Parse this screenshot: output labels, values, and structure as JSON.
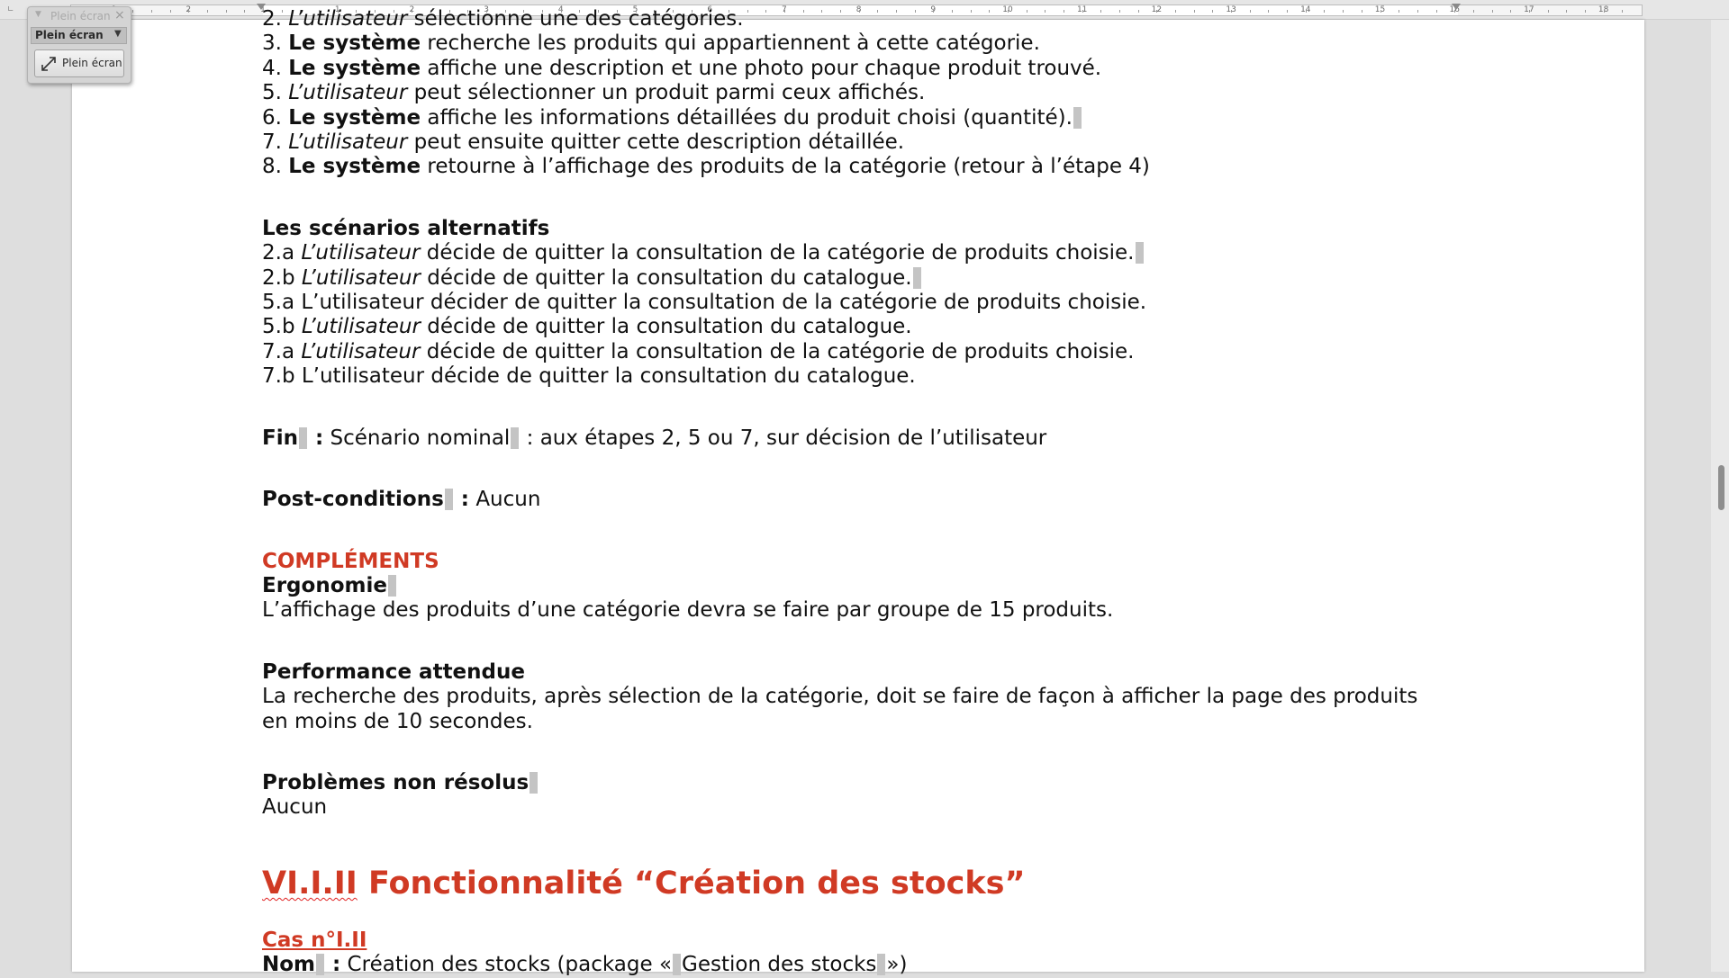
{
  "ruler": {
    "numbers": [
      "1",
      "2",
      "1",
      "1",
      "2",
      "3",
      "4",
      "5",
      "6",
      "7",
      "8",
      "9",
      "10",
      "11",
      "12",
      "13",
      "14",
      "15",
      "16",
      "17",
      "18"
    ]
  },
  "toolbar": {
    "title": "Plein écran",
    "dropdown_label": "Plein écran",
    "button_label": "Plein écran",
    "icons": {
      "menu": "chevron-down-icon",
      "close": "close-icon",
      "dropdown": "triangle-down-icon",
      "button": "fullscreen-icon"
    }
  },
  "document": {
    "top_partial": {
      "num": "2.",
      "actor": "L’utilisateur",
      "rest": " sélectionne une des catégories."
    },
    "steps": [
      {
        "num": "3.",
        "actor": "Le système",
        "actor_style": "bold",
        "rest": " recherche les produits qui appartiennent à cette catégorie.",
        "mark": false
      },
      {
        "num": "4.",
        "actor": "Le système",
        "actor_style": "bold",
        "rest": " affiche une description et une photo pour chaque produit trouvé.",
        "mark": false
      },
      {
        "num": "5.",
        "actor": "L’utilisateur",
        "actor_style": "italic",
        "rest": " peut sélectionner un produit parmi ceux affichés.",
        "mark": false
      },
      {
        "num": "6.",
        "actor": "Le système",
        "actor_style": "bold",
        "rest": " affiche les informations détaillées du produit choisi (quantité).",
        "mark": true
      },
      {
        "num": "7.",
        "actor": "L’utilisateur",
        "actor_style": "italic",
        "rest": " peut ensuite quitter cette description détaillée.",
        "mark": false
      },
      {
        "num": "8.",
        "actor": "Le système",
        "actor_style": "bold",
        "rest": " retourne à l’affichage des produits de la catégorie (retour à l’étape 4)",
        "mark": false
      }
    ],
    "alt_title": "Les scénarios alternatifs",
    "alternatives": [
      {
        "num": "2.a",
        "actor": "L’utilisateur",
        "actor_style": "italic",
        "rest": " décide de quitter la consultation de la catégorie de produits choisie.",
        "mark": true
      },
      {
        "num": "2.b",
        "actor": "L’utilisateur",
        "actor_style": "italic",
        "rest": " décide de quitter la consultation du catalogue.",
        "mark": true
      },
      {
        "num": "5.a",
        "actor": "L’utilisateur",
        "actor_style": "plain",
        "rest": " décider de quitter la consultation de la catégorie de produits choisie.",
        "mark": false
      },
      {
        "num": "5.b",
        "actor": "L’utilisateur",
        "actor_style": "italic",
        "rest": " décide de quitter la consultation du catalogue.",
        "mark": false
      },
      {
        "num": "7.a",
        "actor": "L’utilisateur",
        "actor_style": "italic",
        "rest": " décide de quitter la consultation de la catégorie de produits choisie.",
        "mark": false
      },
      {
        "num": "7.b",
        "actor": "L’utilisateur",
        "actor_style": "plain",
        "rest": " décide de quitter la consultation du catalogue.",
        "mark": false
      }
    ],
    "fin_label": "Fin",
    "fin_colon": " :",
    "fin_text_a": " Scénario nominal",
    "fin_text_b": " : aux étapes 2, 5 ou 7, sur décision de l’utilisateur",
    "post_label": "Post-conditions",
    "post_colon": " :",
    "post_text": " Aucun",
    "complements_title": "COMPLÉMENTS",
    "ergonomie_title": "Ergonomie",
    "ergonomie_text": "L’affichage des produits d’une catégorie devra se faire par groupe de 15 produits.",
    "perf_title": "Performance attendue",
    "perf_text_1": "La recherche des produits, après sélection de la catégorie, doit se faire de façon à afficher la page des produits",
    "perf_text_2": "en moins de 10 secondes.",
    "problems_title": "Problèmes non résolus",
    "problems_text": "Aucun",
    "section_num": "VI.I.II",
    "section_title": " Fonctionnalité “Création des stocks”",
    "case_title": "Cas n°I.II",
    "name_label": "Nom",
    "name_colon": " :",
    "name_text_a": " Création des stocks (package «",
    "name_text_b": "Gestion des stocks",
    "name_text_c": "»)"
  }
}
